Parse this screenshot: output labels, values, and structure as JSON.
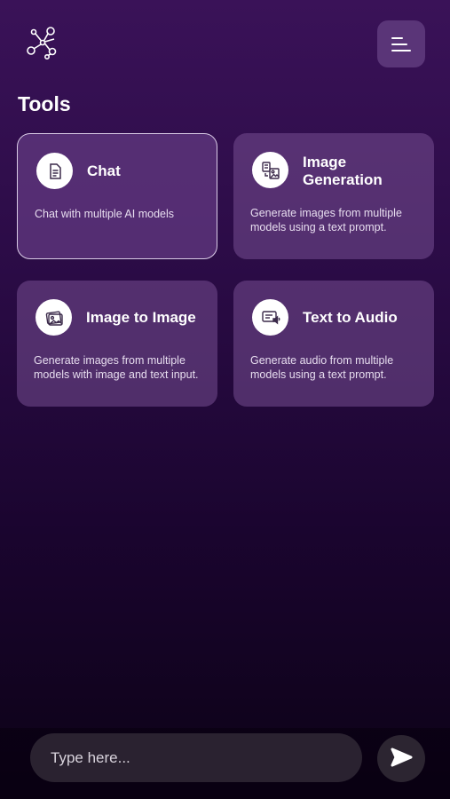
{
  "header": {
    "logo_icon": "network-nodes-icon",
    "menu_icon": "menu-lines-icon"
  },
  "tools": {
    "title": "Tools",
    "cards": [
      {
        "title": "Chat",
        "description": "Chat with multiple AI models",
        "icon": "document-icon",
        "active": true
      },
      {
        "title": "Image Generation",
        "description": "Generate images from multiple models using a text prompt.",
        "icon": "image-generation-icon",
        "active": false
      },
      {
        "title": "Image to Image",
        "description": "Generate images from multiple models with image and text input.",
        "icon": "picture-icon",
        "active": false
      },
      {
        "title": "Text to Audio",
        "description": "Generate audio from multiple models using a text prompt.",
        "icon": "text-audio-icon",
        "active": false
      }
    ]
  },
  "composer": {
    "placeholder": "Type here...",
    "value": "",
    "send_icon": "send-icon"
  },
  "colors": {
    "background_top": "#3a1258",
    "background_bottom": "#0c0216",
    "card": "#764e92",
    "menu_button": "#5a3578",
    "input": "#2a2230"
  }
}
